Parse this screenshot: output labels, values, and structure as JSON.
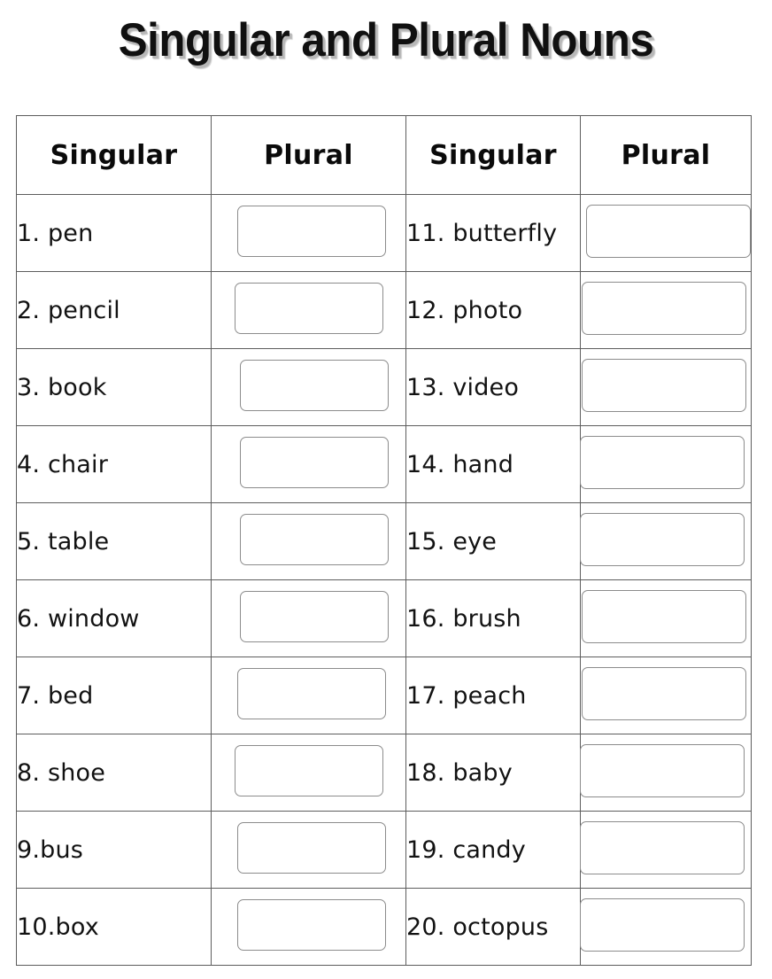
{
  "title": "Singular and Plural Nouns",
  "table": {
    "headers": [
      "Singular",
      "Plural",
      "Singular",
      "Plural"
    ],
    "left_column": [
      "1. pen",
      "2. pencil",
      "3. book",
      "4. chair",
      "5. table",
      "6. window",
      "7. bed",
      "8. shoe",
      "9.bus",
      "10.box"
    ],
    "right_column": [
      "11. butterfly",
      "12. photo",
      "13. video",
      "14. hand",
      "15. eye",
      "16. brush",
      "17. peach",
      "18. baby",
      "19. candy",
      "20. octopus"
    ],
    "answer_value": ""
  }
}
